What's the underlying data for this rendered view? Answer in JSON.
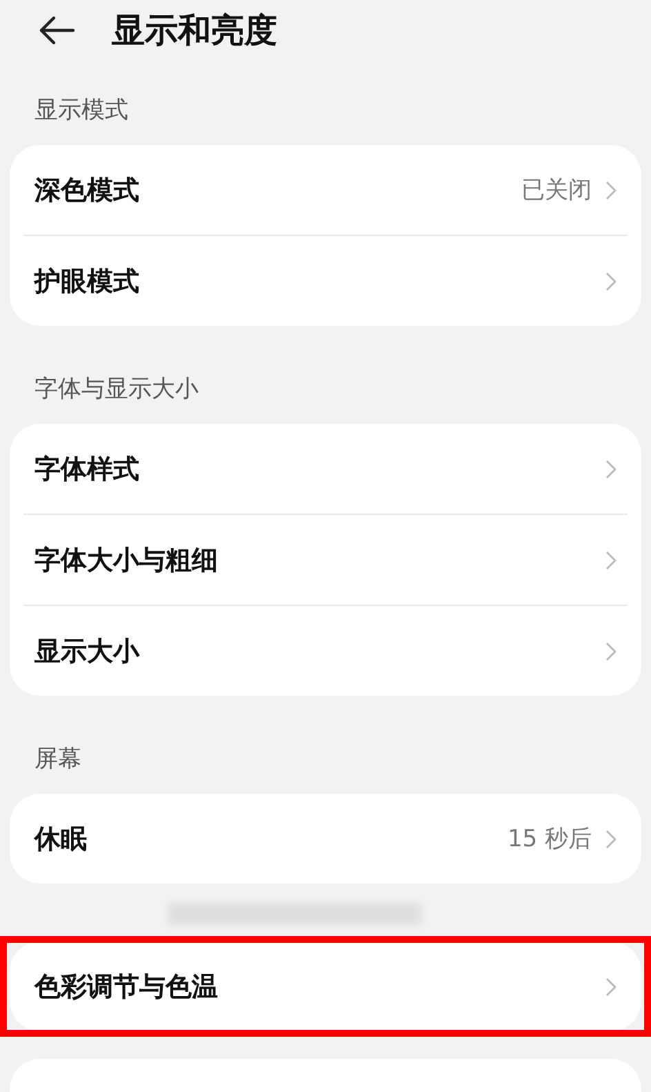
{
  "header": {
    "title": "显示和亮度"
  },
  "sections": [
    {
      "kind": "card",
      "label": "显示模式",
      "items": [
        {
          "title": "深色模式",
          "value": "已关闭",
          "highlighted": false
        },
        {
          "title": "护眼模式",
          "highlighted": false
        }
      ]
    },
    {
      "kind": "card",
      "label": "字体与显示大小",
      "items": [
        {
          "title": "字体样式",
          "highlighted": false
        },
        {
          "title": "字体大小与粗细",
          "highlighted": false
        },
        {
          "title": "显示大小",
          "highlighted": false
        }
      ]
    },
    {
      "kind": "card",
      "label": "屏幕",
      "items": [
        {
          "title": "休眠",
          "value": "15 秒后",
          "highlighted": false
        }
      ]
    },
    {
      "kind": "card",
      "items": [
        {
          "title": "色彩调节与色温",
          "highlighted": true
        }
      ]
    },
    {
      "kind": "partial"
    }
  ]
}
